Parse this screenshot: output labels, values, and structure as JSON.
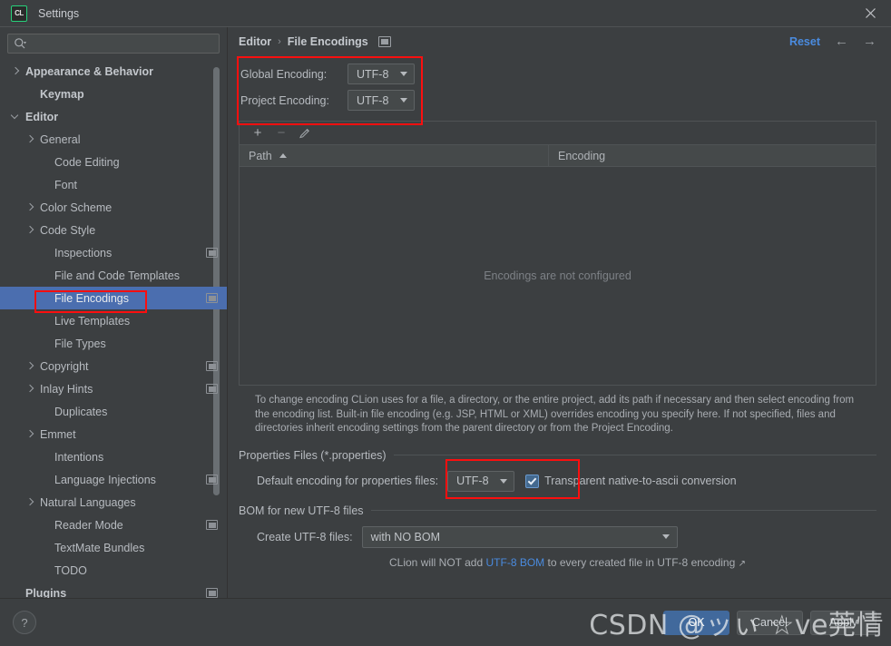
{
  "window": {
    "title": "Settings",
    "app_icon": "clion-icon",
    "close_icon": "close-icon"
  },
  "sidebar": {
    "search": {
      "placeholder": "",
      "value": "",
      "icon": "search-icon"
    },
    "items": [
      {
        "label": "Appearance & Behavior",
        "arrow": "right",
        "indent": 0,
        "bold": true,
        "cfg": false,
        "selected": false
      },
      {
        "label": "Keymap",
        "arrow": "none",
        "indent": 1,
        "bold": true,
        "cfg": false,
        "selected": false
      },
      {
        "label": "Editor",
        "arrow": "down",
        "indent": 0,
        "bold": true,
        "cfg": false,
        "selected": false
      },
      {
        "label": "General",
        "arrow": "right",
        "indent": 1,
        "bold": false,
        "cfg": false,
        "selected": false
      },
      {
        "label": "Code Editing",
        "arrow": "none",
        "indent": 2,
        "bold": false,
        "cfg": false,
        "selected": false
      },
      {
        "label": "Font",
        "arrow": "none",
        "indent": 2,
        "bold": false,
        "cfg": false,
        "selected": false
      },
      {
        "label": "Color Scheme",
        "arrow": "right",
        "indent": 1,
        "bold": false,
        "cfg": false,
        "selected": false
      },
      {
        "label": "Code Style",
        "arrow": "right",
        "indent": 1,
        "bold": false,
        "cfg": false,
        "selected": false
      },
      {
        "label": "Inspections",
        "arrow": "none",
        "indent": 2,
        "bold": false,
        "cfg": true,
        "selected": false
      },
      {
        "label": "File and Code Templates",
        "arrow": "none",
        "indent": 2,
        "bold": false,
        "cfg": false,
        "selected": false
      },
      {
        "label": "File Encodings",
        "arrow": "none",
        "indent": 2,
        "bold": false,
        "cfg": true,
        "selected": true
      },
      {
        "label": "Live Templates",
        "arrow": "none",
        "indent": 2,
        "bold": false,
        "cfg": false,
        "selected": false
      },
      {
        "label": "File Types",
        "arrow": "none",
        "indent": 2,
        "bold": false,
        "cfg": false,
        "selected": false
      },
      {
        "label": "Copyright",
        "arrow": "right",
        "indent": 1,
        "bold": false,
        "cfg": true,
        "selected": false
      },
      {
        "label": "Inlay Hints",
        "arrow": "right",
        "indent": 1,
        "bold": false,
        "cfg": true,
        "selected": false
      },
      {
        "label": "Duplicates",
        "arrow": "none",
        "indent": 2,
        "bold": false,
        "cfg": false,
        "selected": false
      },
      {
        "label": "Emmet",
        "arrow": "right",
        "indent": 1,
        "bold": false,
        "cfg": false,
        "selected": false
      },
      {
        "label": "Intentions",
        "arrow": "none",
        "indent": 2,
        "bold": false,
        "cfg": false,
        "selected": false
      },
      {
        "label": "Language Injections",
        "arrow": "none",
        "indent": 2,
        "bold": false,
        "cfg": true,
        "selected": false
      },
      {
        "label": "Natural Languages",
        "arrow": "right",
        "indent": 1,
        "bold": false,
        "cfg": false,
        "selected": false
      },
      {
        "label": "Reader Mode",
        "arrow": "none",
        "indent": 2,
        "bold": false,
        "cfg": true,
        "selected": false
      },
      {
        "label": "TextMate Bundles",
        "arrow": "none",
        "indent": 2,
        "bold": false,
        "cfg": false,
        "selected": false
      },
      {
        "label": "TODO",
        "arrow": "none",
        "indent": 2,
        "bold": false,
        "cfg": false,
        "selected": false
      },
      {
        "label": "Plugins",
        "arrow": "none",
        "indent": 0,
        "bold": true,
        "cfg": true,
        "selected": false
      }
    ]
  },
  "header": {
    "breadcrumb_parent": "Editor",
    "breadcrumb_sep": "›",
    "breadcrumb_current": "File Encodings",
    "reset_label": "Reset",
    "back_icon": "←",
    "forward_icon": "→"
  },
  "encodings": {
    "global_label": "Global Encoding:",
    "global_value": "UTF-8",
    "project_label": "Project Encoding:",
    "project_value": "UTF-8"
  },
  "table": {
    "toolbar": {
      "add": "+",
      "remove": "−",
      "edit": "✎"
    },
    "columns": [
      "Path",
      "Encoding"
    ],
    "sort_column": "Path",
    "sort_direction": "asc",
    "rows": [],
    "empty_message": "Encodings are not configured"
  },
  "help_text": "To change encoding CLion uses for a file, a directory, or the entire project, add its path if necessary and then select encoding from the encoding list. Built-in file encoding (e.g. JSP, HTML or XML) overrides encoding you specify here. If not specified, files and directories inherit encoding settings from the parent directory or from the Project Encoding.",
  "properties_group": {
    "title": "Properties Files (*.properties)",
    "default_encoding_label": "Default encoding for properties files:",
    "default_encoding_value": "UTF-8",
    "transparent_label": "Transparent native-to-ascii conversion",
    "transparent_checked": true
  },
  "bom_group": {
    "title": "BOM for new UTF-8 files",
    "create_label": "Create UTF-8 files:",
    "create_value": "with NO BOM",
    "note_prefix": "CLion will NOT add ",
    "note_link": "UTF-8 BOM",
    "note_suffix": " to every created file in UTF-8 encoding ",
    "note_external_icon": "↗"
  },
  "footer": {
    "help_icon": "?",
    "ok_label": "OK",
    "cancel_label": "Cancel",
    "apply_label": "Apply"
  },
  "watermark": "CSDN @ッぃ ☆ve莞情",
  "colors": {
    "background": "#3c3f41",
    "selection": "#4b6eaf",
    "accent_link": "#4a8bdf",
    "annotation": "#fb0f0f",
    "primary_button": "#41699c"
  }
}
